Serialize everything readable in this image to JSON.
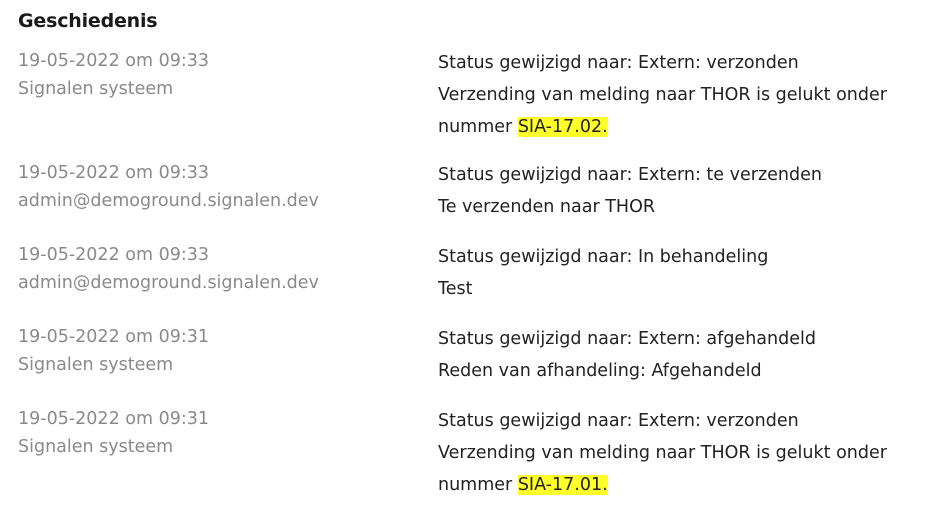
{
  "history": {
    "title": "Geschiedenis",
    "entries": [
      {
        "datetime": "19-05-2022 om 09:33",
        "author": "Signalen systeem",
        "line1": "Status gewijzigd naar: Extern: verzonden",
        "line2": "Verzending van melding naar THOR is gelukt onder",
        "line3_prefix": "nummer ",
        "line3_highlight": "SIA-17.02."
      },
      {
        "datetime": "19-05-2022 om 09:33",
        "author": "admin@demoground.signalen.dev",
        "line1": "Status gewijzigd naar: Extern: te verzenden",
        "line2": "Te verzenden naar THOR"
      },
      {
        "datetime": "19-05-2022 om 09:33",
        "author": "admin@demoground.signalen.dev",
        "line1": "Status gewijzigd naar: In behandeling",
        "line2": "Test"
      },
      {
        "datetime": "19-05-2022 om 09:31",
        "author": "Signalen systeem",
        "line1": "Status gewijzigd naar: Extern: afgehandeld",
        "line2": "Reden van afhandeling: Afgehandeld"
      },
      {
        "datetime": "19-05-2022 om 09:31",
        "author": "Signalen systeem",
        "line1": "Status gewijzigd naar: Extern: verzonden",
        "line2": "Verzending van melding naar THOR is gelukt onder",
        "line3_prefix": "nummer ",
        "line3_highlight": "SIA-17.01."
      }
    ],
    "colors": {
      "highlight": "#ffff29",
      "meta_text": "#8a8a8a",
      "body_text": "#222222"
    }
  }
}
